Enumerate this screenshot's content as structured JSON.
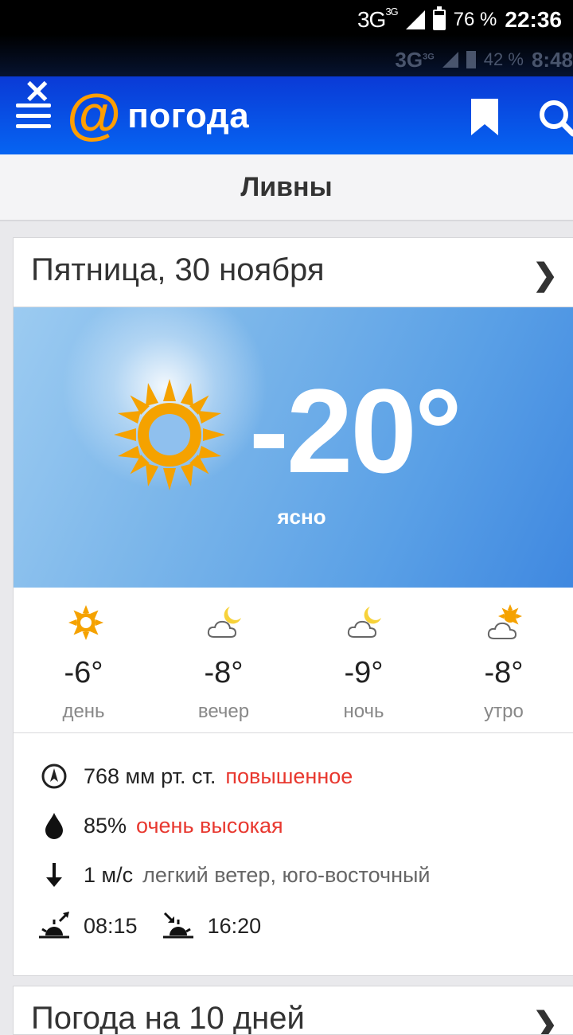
{
  "status_bar": {
    "network": "3G",
    "network_sup": "3G",
    "battery": "76 %",
    "time": "22:36",
    "ghost": {
      "network": "3G",
      "network_sup": "3G",
      "battery": "42 %",
      "time": "8:48"
    }
  },
  "header": {
    "close": "✕",
    "logo_symbol": "@",
    "logo_text": "погода",
    "icons": [
      "menu-icon",
      "bookmark-icon",
      "search-icon"
    ]
  },
  "city": "Ливны",
  "forecast": {
    "date": "Пятница, 30 ноября",
    "temperature": "-20°",
    "condition": "ясно",
    "periods": [
      {
        "temp": "-6°",
        "label": "день",
        "icon": "sun"
      },
      {
        "temp": "-8°",
        "label": "вечер",
        "icon": "moon-cloud"
      },
      {
        "temp": "-9°",
        "label": "ночь",
        "icon": "moon-cloud"
      },
      {
        "temp": "-8°",
        "label": "утро",
        "icon": "sun-cloud"
      }
    ],
    "pressure": {
      "value": "768 мм рт. ст.",
      "note": "повышенное"
    },
    "humidity": {
      "value": "85%",
      "note": "очень высокая"
    },
    "wind": {
      "value": "1 м/с",
      "note": "легкий ветер, юго-восточный"
    },
    "sunrise": "08:15",
    "sunset": "16:20"
  },
  "ten_day_title": "Погода на 10 дней",
  "colors": {
    "header": "#0a4ce6",
    "accent": "#ff9e00",
    "warning": "#e8382f"
  }
}
